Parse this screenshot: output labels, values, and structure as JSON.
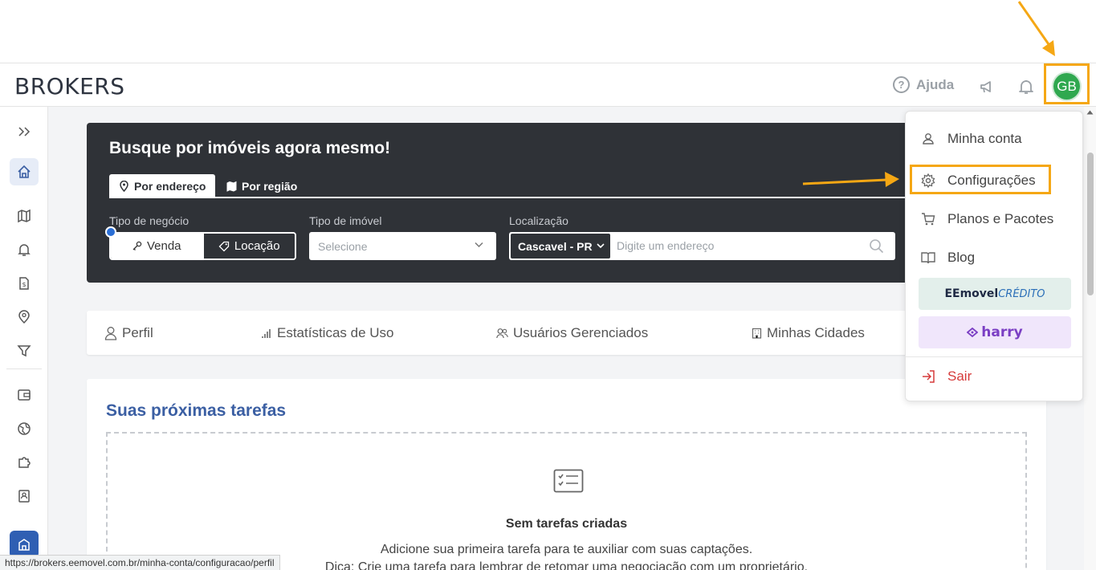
{
  "header": {
    "logo": "BROKERS",
    "help_label": "Ajuda",
    "avatar_initials": "GB"
  },
  "search": {
    "title": "Busque por imóveis agora mesmo!",
    "tab_address": "Por endereço",
    "tab_region": "Por região",
    "business_label": "Tipo de negócio",
    "business_options": [
      "Venda",
      "Locação"
    ],
    "business_selected": "Locação",
    "property_label": "Tipo de imóvel",
    "property_placeholder": "Selecione",
    "location_label": "Localização",
    "city": "Cascavel - PR",
    "address_placeholder": "Digite um endereço"
  },
  "profile_tabs": [
    "Perfil",
    "Estatísticas de Uso",
    "Usuários Gerenciados",
    "Minhas Cidades"
  ],
  "tasks": {
    "title": "Suas próximas tarefas",
    "empty_title": "Sem tarefas criadas",
    "empty_sub": "Adicione sua primeira tarefa para te auxiliar com suas captações.",
    "empty_tip": "Dica: Crie uma tarefa para lembrar de retomar uma negociação com um proprietário."
  },
  "menu": {
    "my_account": "Minha conta",
    "settings": "Configurações",
    "plans": "Planos e Pacotes",
    "blog": "Blog",
    "credito_brand": "EEmovel",
    "credito_word": "CRÉDITO",
    "harry": "harry",
    "logout": "Sair"
  },
  "status_url": "https://brokers.eemovel.com.br/minha-conta/configuracao/perfil",
  "colors": {
    "accent_orange": "#f5a714",
    "dark_panel": "#2f3237",
    "title_blue": "#3b5fa3",
    "avatar_green": "#2fa84f",
    "logout_red": "#d63a3a"
  }
}
